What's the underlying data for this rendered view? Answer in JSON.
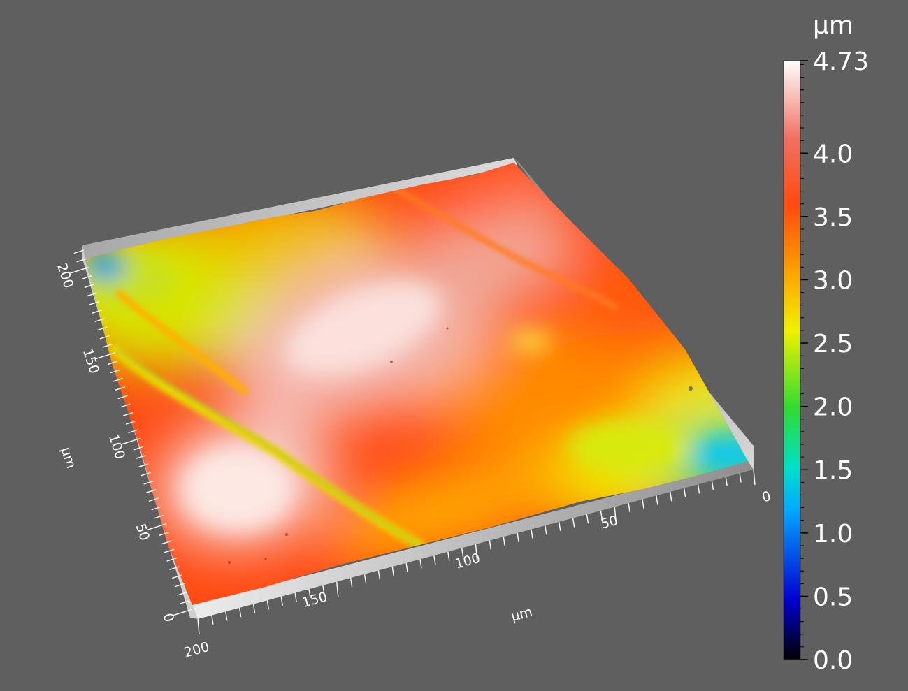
{
  "chart_data": {
    "type": "heatmap",
    "render": "3d-surface",
    "x_axis": {
      "label": "µm",
      "ticks": [
        "0",
        "50",
        "100",
        "150",
        "200"
      ],
      "range": [
        0,
        200
      ]
    },
    "y_axis": {
      "label": "µm",
      "ticks": [
        "0",
        "50",
        "100",
        "150",
        "200"
      ],
      "range": [
        0,
        210
      ]
    },
    "colorbar": {
      "unit": "µm",
      "range": [
        0.0,
        4.73
      ],
      "tick_labels": [
        "4.73",
        "4.0",
        "3.5",
        "3.0",
        "2.5",
        "2.0",
        "1.5",
        "1.0",
        "0.5",
        "0.0"
      ],
      "tick_values": [
        4.73,
        4.0,
        3.5,
        3.0,
        2.5,
        2.0,
        1.5,
        1.0,
        0.5,
        0.0
      ],
      "colormap": [
        [
          0.0,
          "#000000"
        ],
        [
          0.1,
          "#0000d0"
        ],
        [
          0.25,
          "#00a8ff"
        ],
        [
          0.32,
          "#00e0c8"
        ],
        [
          0.42,
          "#30dc30"
        ],
        [
          0.55,
          "#f0f000"
        ],
        [
          0.65,
          "#ffa000"
        ],
        [
          0.76,
          "#ff4a10"
        ],
        [
          0.87,
          "#f07060"
        ],
        [
          1.0,
          "#ffffff"
        ]
      ]
    }
  },
  "colors": {
    "background": "#5f5f5f",
    "base_light": "#e0e0e0",
    "base_dark": "#9a9a9a"
  }
}
